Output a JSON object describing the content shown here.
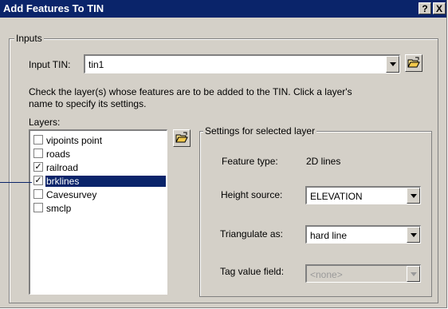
{
  "window": {
    "title": "Add Features To TIN",
    "help_label": "?",
    "close_label": "X"
  },
  "inputs": {
    "group_label": "Inputs",
    "input_tin_label": "Input TIN:",
    "input_tin_value": "tin1",
    "instructions": [
      "Check the layer(s) whose features are to be added to the TIN. Click a layer's",
      "name to specify its settings."
    ],
    "layers_label": "Layers:",
    "layers": [
      {
        "name": "vipoints point",
        "checked": false,
        "selected": false
      },
      {
        "name": "roads",
        "checked": false,
        "selected": false
      },
      {
        "name": "railroad",
        "checked": true,
        "selected": false
      },
      {
        "name": "brklines",
        "checked": true,
        "selected": true
      },
      {
        "name": "Cavesurvey",
        "checked": false,
        "selected": false
      },
      {
        "name": "smclp",
        "checked": false,
        "selected": false
      }
    ]
  },
  "settings": {
    "group_label": "Settings for selected layer",
    "feature_type_label": "Feature type:",
    "feature_type_value": "2D lines",
    "height_source_label": "Height source:",
    "height_source_value": "ELEVATION",
    "triangulate_label": "Triangulate as:",
    "triangulate_value": "hard line",
    "tag_value_label": "Tag value field:",
    "tag_value_value": "<none>"
  },
  "icons": {
    "open_folder": "open-folder-icon",
    "dropdown": "chevron-down-icon",
    "check": "check-icon"
  },
  "colors": {
    "titlebar": "#0a246a",
    "face": "#d4d0c8",
    "selection": "#0a246a"
  }
}
